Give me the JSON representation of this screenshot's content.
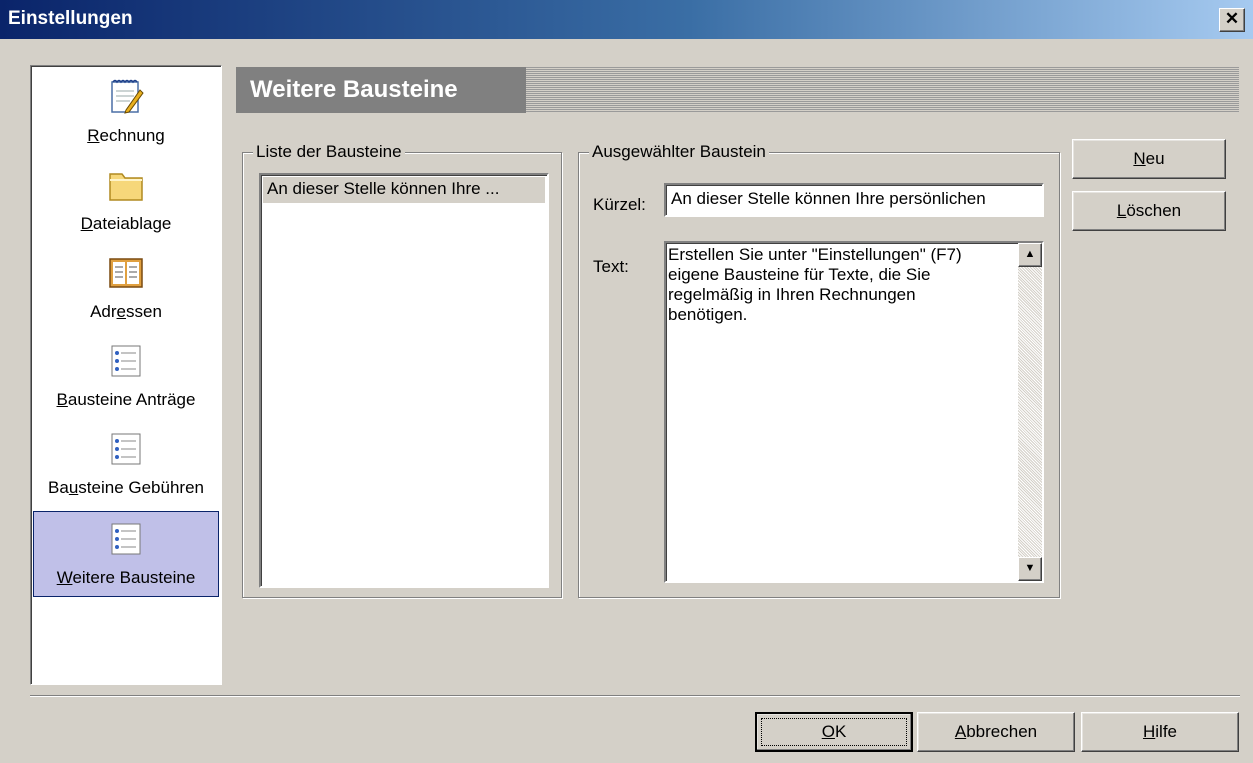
{
  "window": {
    "title": "Einstellungen",
    "close_label": "✕"
  },
  "sidebar": {
    "items": [
      {
        "label_before": "",
        "label_key": "R",
        "label_after": "echnung",
        "icon": "notepad-icon"
      },
      {
        "label_before": "",
        "label_key": "D",
        "label_after": "ateiablage",
        "icon": "folder-icon"
      },
      {
        "label_before": "Adr",
        "label_key": "e",
        "label_after": "ssen",
        "icon": "address-book-icon"
      },
      {
        "label_before": "",
        "label_key": "B",
        "label_after": "austeine Anträge",
        "icon": "text-blocks-icon"
      },
      {
        "label_before": "Ba",
        "label_key": "u",
        "label_after": "steine Gebühren",
        "icon": "text-blocks-icon"
      },
      {
        "label_before": "",
        "label_key": "W",
        "label_after": "eitere Bausteine",
        "icon": "text-blocks-icon",
        "selected": true
      }
    ]
  },
  "header": {
    "title": "Weitere Bausteine"
  },
  "list_group": {
    "legend": "Liste der Bausteine",
    "items": [
      "An dieser Stelle können Ihre ..."
    ]
  },
  "detail_group": {
    "legend": "Ausgewählter Baustein",
    "kuerzel_label": "Kürzel:",
    "kuerzel_value": "An dieser Stelle können Ihre persönlichen",
    "text_label": "Text:",
    "text_value": "Erstellen Sie unter \"Einstellungen\" (F7)\neigene Bausteine für Texte, die Sie\nregelmäßig in Ihren Rechnungen\nbenötigen."
  },
  "side_buttons": {
    "new_key": "N",
    "new_rest": "eu",
    "delete_key": "L",
    "delete_rest": "öschen"
  },
  "footer": {
    "ok_key": "O",
    "ok_rest": "K",
    "cancel_key": "A",
    "cancel_rest": "bbrechen",
    "help_key": "H",
    "help_rest": "ilfe"
  }
}
